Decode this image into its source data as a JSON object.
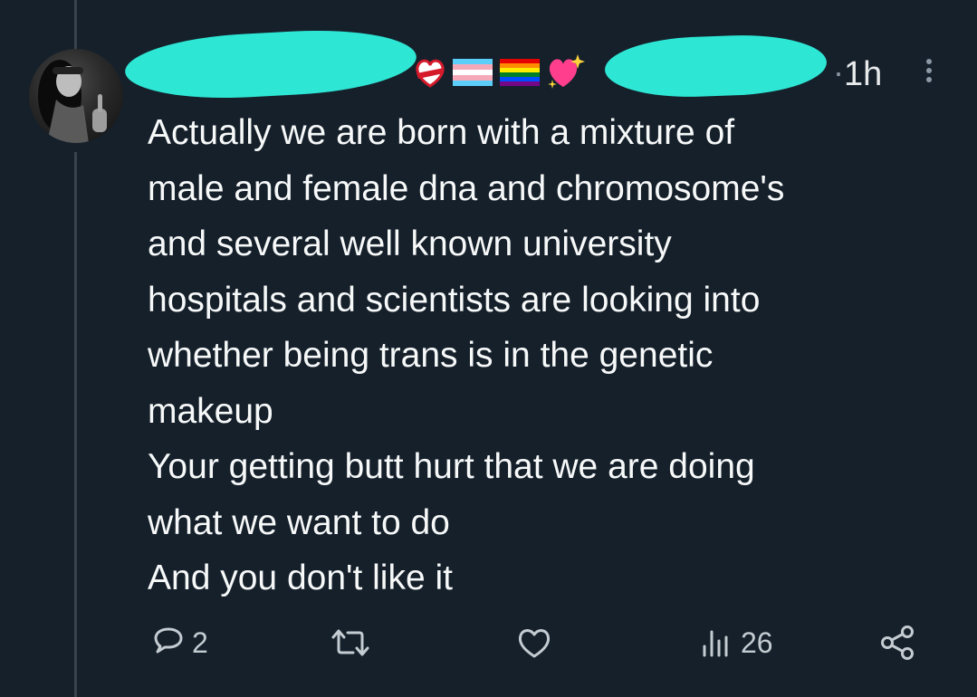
{
  "tweet": {
    "time": "1h",
    "separator": "·",
    "text_lines": [
      "Actually we are born with a mixture of",
      "male and female dna and chromosome's",
      "and several well known university",
      "hospitals and scientists are looking into",
      "whether being trans is in the genetic",
      "makeup",
      "Your getting butt hurt that we are doing",
      "what we want to do",
      "And you don't like it"
    ],
    "display_name_redacted": true,
    "handle_redacted": true,
    "redaction_color": "#2ee6d4",
    "name_emojis": [
      "flag-heart-emoji",
      "trans-flag-emoji",
      "rainbow-flag-emoji",
      "sparkling-heart-emoji"
    ]
  },
  "actions": {
    "reply_count": "2",
    "retweet_count": "",
    "like_count": "",
    "view_count": "26"
  },
  "colors": {
    "background": "#15202b",
    "text": "#f7f9f9",
    "muted": "#8b98a5",
    "icon": "#c4cbd1",
    "thread_line": "#38444d"
  }
}
